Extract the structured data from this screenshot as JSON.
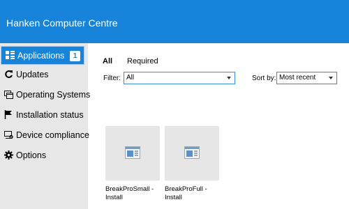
{
  "header": {
    "title": "Hanken Computer Centre"
  },
  "sidebar": {
    "items": [
      {
        "label": "Applications",
        "icon": "applications-grid-icon",
        "badge": "1",
        "active": true
      },
      {
        "label": "Updates",
        "icon": "refresh-icon"
      },
      {
        "label": "Operating Systems",
        "icon": "operating-systems-icon"
      },
      {
        "label": "Installation status",
        "icon": "flag-icon"
      },
      {
        "label": "Device compliance",
        "icon": "device-compliance-icon"
      },
      {
        "label": "Options",
        "icon": "gear-icon"
      }
    ]
  },
  "main": {
    "tabs": [
      {
        "label": "All",
        "active": true
      },
      {
        "label": "Required"
      }
    ],
    "filter": {
      "label": "Filter:",
      "value": "All"
    },
    "sort": {
      "label": "Sort by:",
      "value": "Most recent"
    },
    "apps": [
      {
        "name": "BreakProSmall - Install",
        "icon": "application-window-icon"
      },
      {
        "name": "BreakProFull - Install",
        "icon": "application-window-icon"
      }
    ]
  },
  "colors": {
    "accent": "#1784d9",
    "sidebar_bg": "#e7e7e7",
    "tile_bg": "#e6e6e6"
  }
}
